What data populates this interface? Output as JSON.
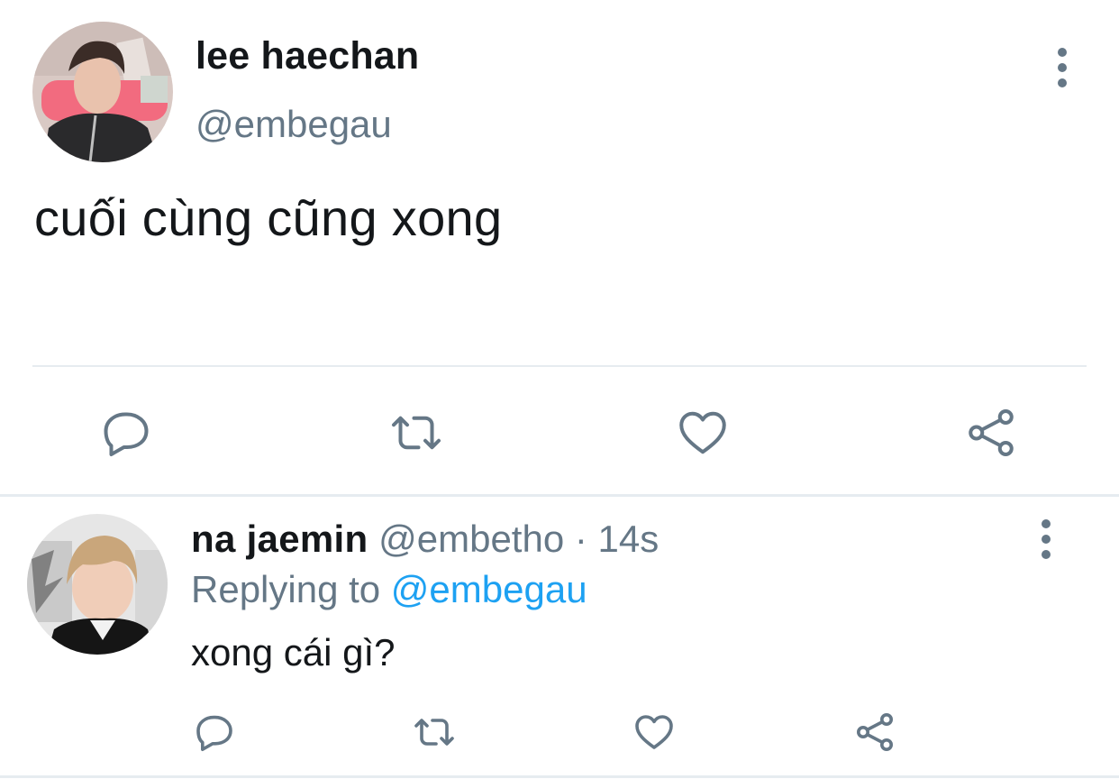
{
  "main_tweet": {
    "display_name": "lee haechan",
    "handle": "@embegau",
    "text": "cuối cùng cũng xong",
    "avatar_icon": "profile-photo-icon",
    "actions": [
      "reply-icon",
      "retweet-icon",
      "like-icon",
      "share-icon"
    ]
  },
  "reply_tweet": {
    "display_name": "na jaemin",
    "handle": "@embetho",
    "separator": " · ",
    "time": "14s",
    "replying_prefix": "Replying to ",
    "replying_to": "@embegau",
    "text": "xong cái gì?",
    "avatar_icon": "profile-photo-icon",
    "actions": [
      "reply-icon",
      "retweet-icon",
      "like-icon",
      "share-icon"
    ]
  },
  "colors": {
    "text_primary": "#14171a",
    "text_secondary": "#657786",
    "link": "#1da1f2",
    "divider": "#e6ecf0",
    "icon": "#657786"
  }
}
